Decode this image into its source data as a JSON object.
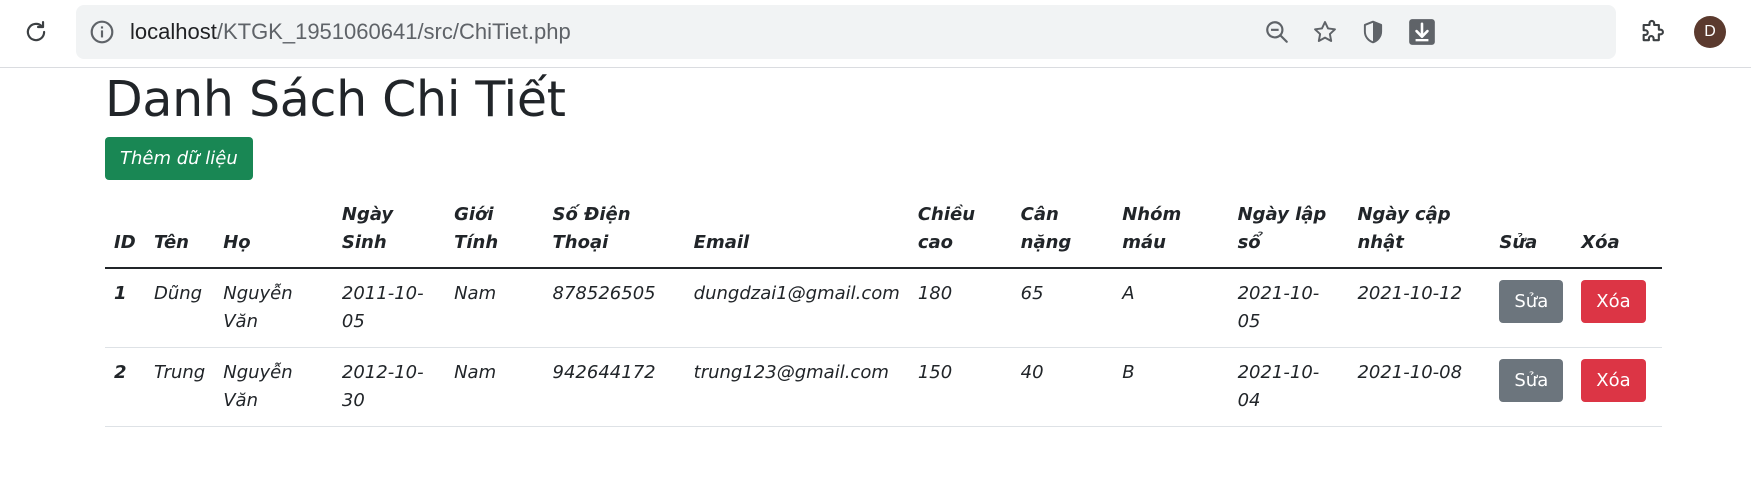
{
  "browser": {
    "url_host": "localhost",
    "url_path": "/KTGK_1951060641/src/ChiTiet.php",
    "avatar_letter": "D",
    "icons": [
      "reload-icon",
      "info-icon",
      "zoom-out-icon",
      "star-icon",
      "shield-icon",
      "download-icon",
      "extensions-icon"
    ],
    "download_color": "#5f6368"
  },
  "page": {
    "title": "Danh Sách Chi Tiết",
    "add_button": "Thêm dữ liệu"
  },
  "table": {
    "headers": [
      "ID",
      "Tên",
      "Họ",
      "Ngày Sinh",
      "Giới Tính",
      "Số Điện Thoại",
      "Email",
      "Chiều cao",
      "Cân nặng",
      "Nhóm máu",
      "Ngày lập sổ",
      "Ngày cập nhật",
      "Sửa",
      "Xóa"
    ],
    "rows": [
      {
        "id": "1",
        "ten": "Dũng",
        "ho": "Nguyễn Văn",
        "ngay_sinh": "2011-10-05",
        "gioi_tinh": "Nam",
        "sdt": "878526505",
        "email": "dungdzai1@gmail.com",
        "chieu_cao": "180",
        "can_nang": "65",
        "nhom_mau": "A",
        "ngay_lap": "2021-10-05",
        "ngay_cap_nhat": "2021-10-12",
        "sua": "Sửa",
        "xoa": "Xóa"
      },
      {
        "id": "2",
        "ten": "Trung",
        "ho": "Nguyễn Văn",
        "ngay_sinh": "2012-10-30",
        "gioi_tinh": "Nam",
        "sdt": "942644172",
        "email": "trung123@gmail.com",
        "chieu_cao": "150",
        "can_nang": "40",
        "nhom_mau": "B",
        "ngay_lap": "2021-10-04",
        "ngay_cap_nhat": "2021-10-08",
        "sua": "Sửa",
        "xoa": "Xóa"
      }
    ]
  },
  "colors": {
    "add_button": "#198754",
    "edit_button": "#6c757d",
    "delete_button": "#dc3545"
  }
}
